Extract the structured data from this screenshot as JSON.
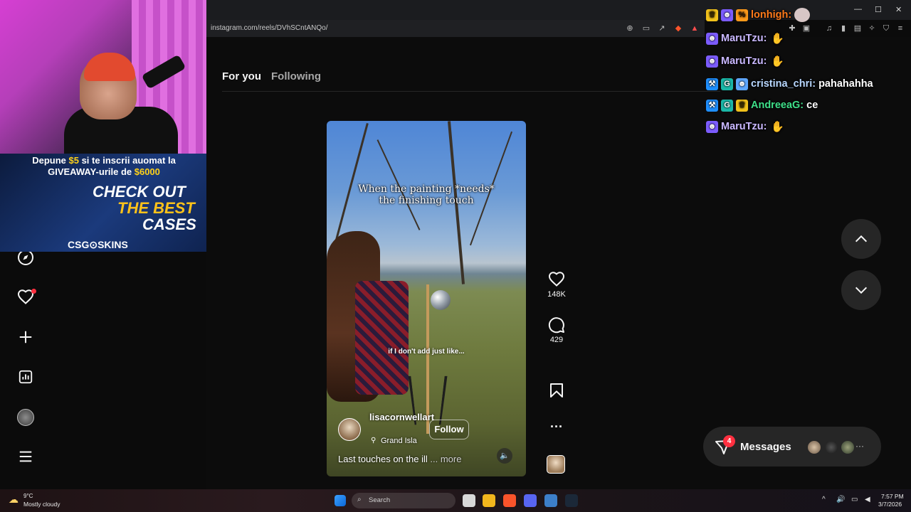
{
  "browser": {
    "url": "instagram.com/reels/DVhSCntANQo/",
    "window_controls": [
      "—",
      "☐",
      "✕"
    ]
  },
  "feed": {
    "tabs": [
      {
        "label": "For you",
        "active": true
      },
      {
        "label": "Following",
        "active": false
      }
    ]
  },
  "reel": {
    "overlay_caption": "When the painting *needs*\nthe finishing touch",
    "mid_caption": "if I don't add just like...",
    "username": "lisacornwellart",
    "follow_label": "Follow",
    "location": "Grand Isla",
    "description": "Last touches on the ill",
    "more_label": "... more",
    "likes": "148K",
    "comments": "429"
  },
  "messages": {
    "label": "Messages",
    "badge": "4"
  },
  "stream_overlay": {
    "promo": {
      "line1_a": "Depune ",
      "line1_amount": "$5",
      "line1_b": " si te inscrii auomat la",
      "line2_a": "GIVEAWAY-urile de ",
      "line2_amount": "$6000",
      "check": "CHECK OUT",
      "best": "THE BEST",
      "cases": "CASES",
      "brand": "CSG⊙SKINS"
    },
    "chat": [
      {
        "user": "lonhigh:",
        "user_color": "#ff7a1a",
        "text": "",
        "badges": [
          "crown",
          "mask",
          "percent"
        ],
        "emote": "avatar"
      },
      {
        "user": "MaruTzu:",
        "user_color": "#c9b8ff",
        "text": "",
        "badges": [
          "mask"
        ],
        "emote": "hands"
      },
      {
        "user": "MaruTzu:",
        "user_color": "#c9b8ff",
        "text": "",
        "badges": [
          "mask"
        ],
        "emote": "hands"
      },
      {
        "user": "cristina_chri:",
        "user_color": "#b8d7ff",
        "text": "pahahahha",
        "badges": [
          "hammer",
          "gg",
          "mask"
        ],
        "emote": ""
      },
      {
        "user": "AndreeaG:",
        "user_color": "#3fe08a",
        "text": "ce",
        "badges": [
          "hammer",
          "gg",
          "crown-small"
        ],
        "emote": ""
      },
      {
        "user": "MaruTzu:",
        "user_color": "#c9b8ff",
        "text": "",
        "badges": [
          "mask"
        ],
        "emote": "hands"
      }
    ]
  },
  "taskbar": {
    "weather_temp": "9°C",
    "weather_desc": "Mostly cloudy",
    "search_label": "Search",
    "time": "7:57 PM",
    "date": "3/7/2026"
  },
  "colors": {
    "accent_red": "#ff3040",
    "background": "#0c0c0c"
  }
}
